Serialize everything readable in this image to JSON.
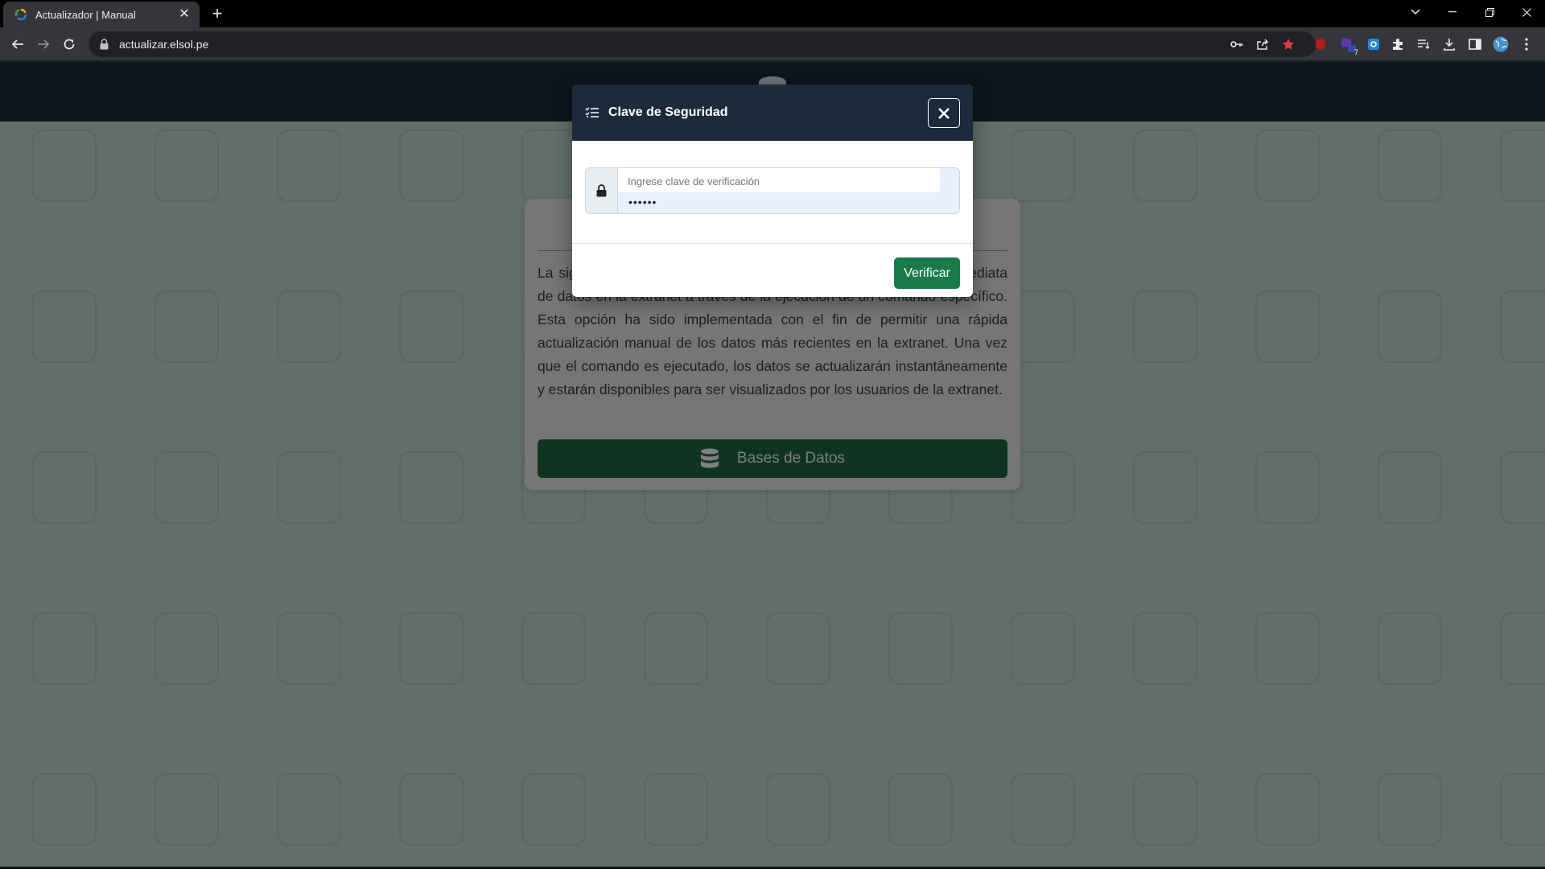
{
  "browser": {
    "tab_title": "Actualizador | Manual",
    "url": "actualizar.elsol.pe",
    "extension_badge": "7",
    "close_tab_glyph": "✕",
    "new_tab_glyph": "+"
  },
  "icons": {
    "favicon": "refresh-logo-icon",
    "lock": "lock-icon",
    "key": "key-icon",
    "share": "share-icon",
    "bookmark": "star-icon",
    "extensions": "puzzle-icon",
    "download": "download-icon",
    "database": "database-icon",
    "list": "list-icon",
    "close": "close-icon"
  },
  "colors": {
    "header": "#1c2b3b",
    "page_bg": "#c2ded0",
    "primary_green": "#1f6b45",
    "verify_green": "#1a7a4a",
    "bookmark_star": "#e53935"
  },
  "card": {
    "description": "La siguiente herramienta permite llevar a cabo la actualización inmediata de datos en la extranet a través de la ejecución de un comando específico. Esta opción ha sido implementada con el fin de permitir una rápida actualización manual de los datos más recientes en la extranet. Una vez que el comando es ejecutado, los datos se actualizarán instantáneamente y estarán disponibles para ser visualizados por los usuarios de la extranet.",
    "button_label": "Bases de Datos"
  },
  "modal": {
    "title": "Clave de Seguridad",
    "input_label": "Ingrese clave de verificación",
    "input_value": "••••••",
    "verify_label": "Verificar"
  }
}
